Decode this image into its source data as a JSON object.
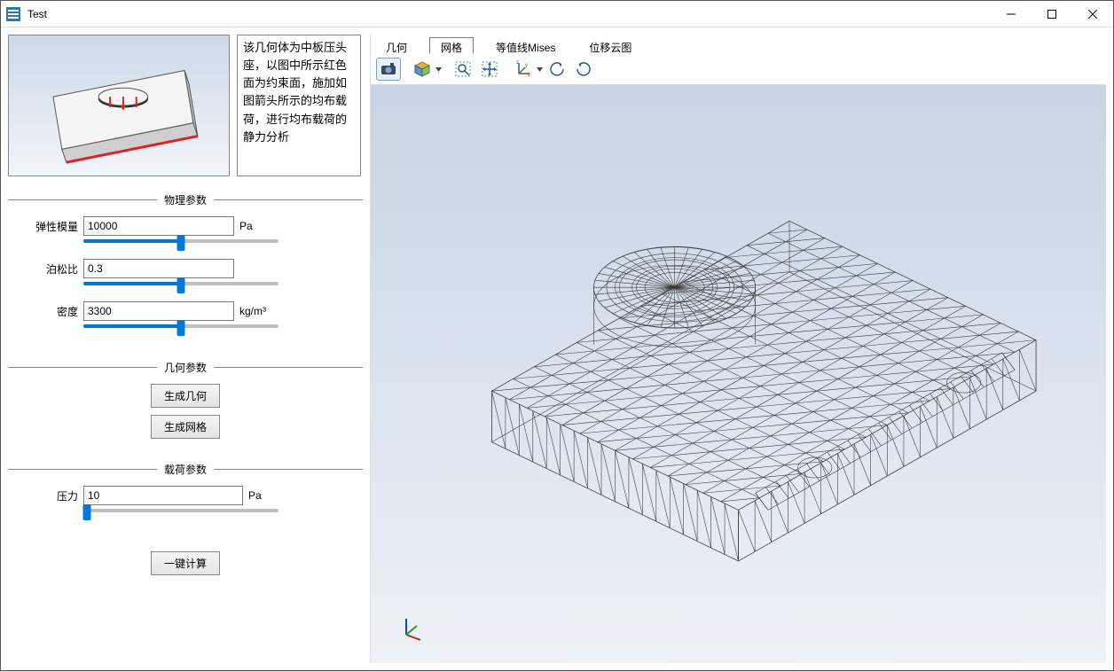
{
  "window": {
    "title": "Test"
  },
  "description": "该几何体为中板压头座，以图中所示红色面为约束面，施加如图箭头所示的均布载荷，进行均布载荷的静力分析",
  "sections": {
    "physical": {
      "title": "物理参数",
      "elastic_modulus": {
        "label": "弹性模量",
        "value": "10000",
        "unit": "Pa",
        "slider_pct": 50
      },
      "poisson": {
        "label": "泊松比",
        "value": "0.3",
        "unit": "",
        "slider_pct": 50
      },
      "density": {
        "label": "密度",
        "value": "3300",
        "unit": "kg/m³",
        "slider_pct": 50
      }
    },
    "geometry": {
      "title": "几何参数",
      "btn_gen_geometry": "生成几何",
      "btn_gen_mesh": "生成网格"
    },
    "load": {
      "title": "载荷参数",
      "pressure": {
        "label": "压力",
        "value": "10",
        "unit": "Pa",
        "slider_pct": 2
      }
    },
    "compute_btn": "一键计算"
  },
  "tabs": {
    "geometry": "几何",
    "mesh": "网格",
    "mises": "等值线Mises",
    "disp": "位移云图",
    "active": "mesh"
  },
  "toolbar_icons": {
    "camera": "camera-icon",
    "cube": "cube-icon",
    "zoom_box": "zoom-box-icon",
    "pan": "pan-icon",
    "axes": "axes-icon",
    "rotate_ccw": "rotate-ccw-icon",
    "rotate_cw": "rotate-cw-icon"
  }
}
